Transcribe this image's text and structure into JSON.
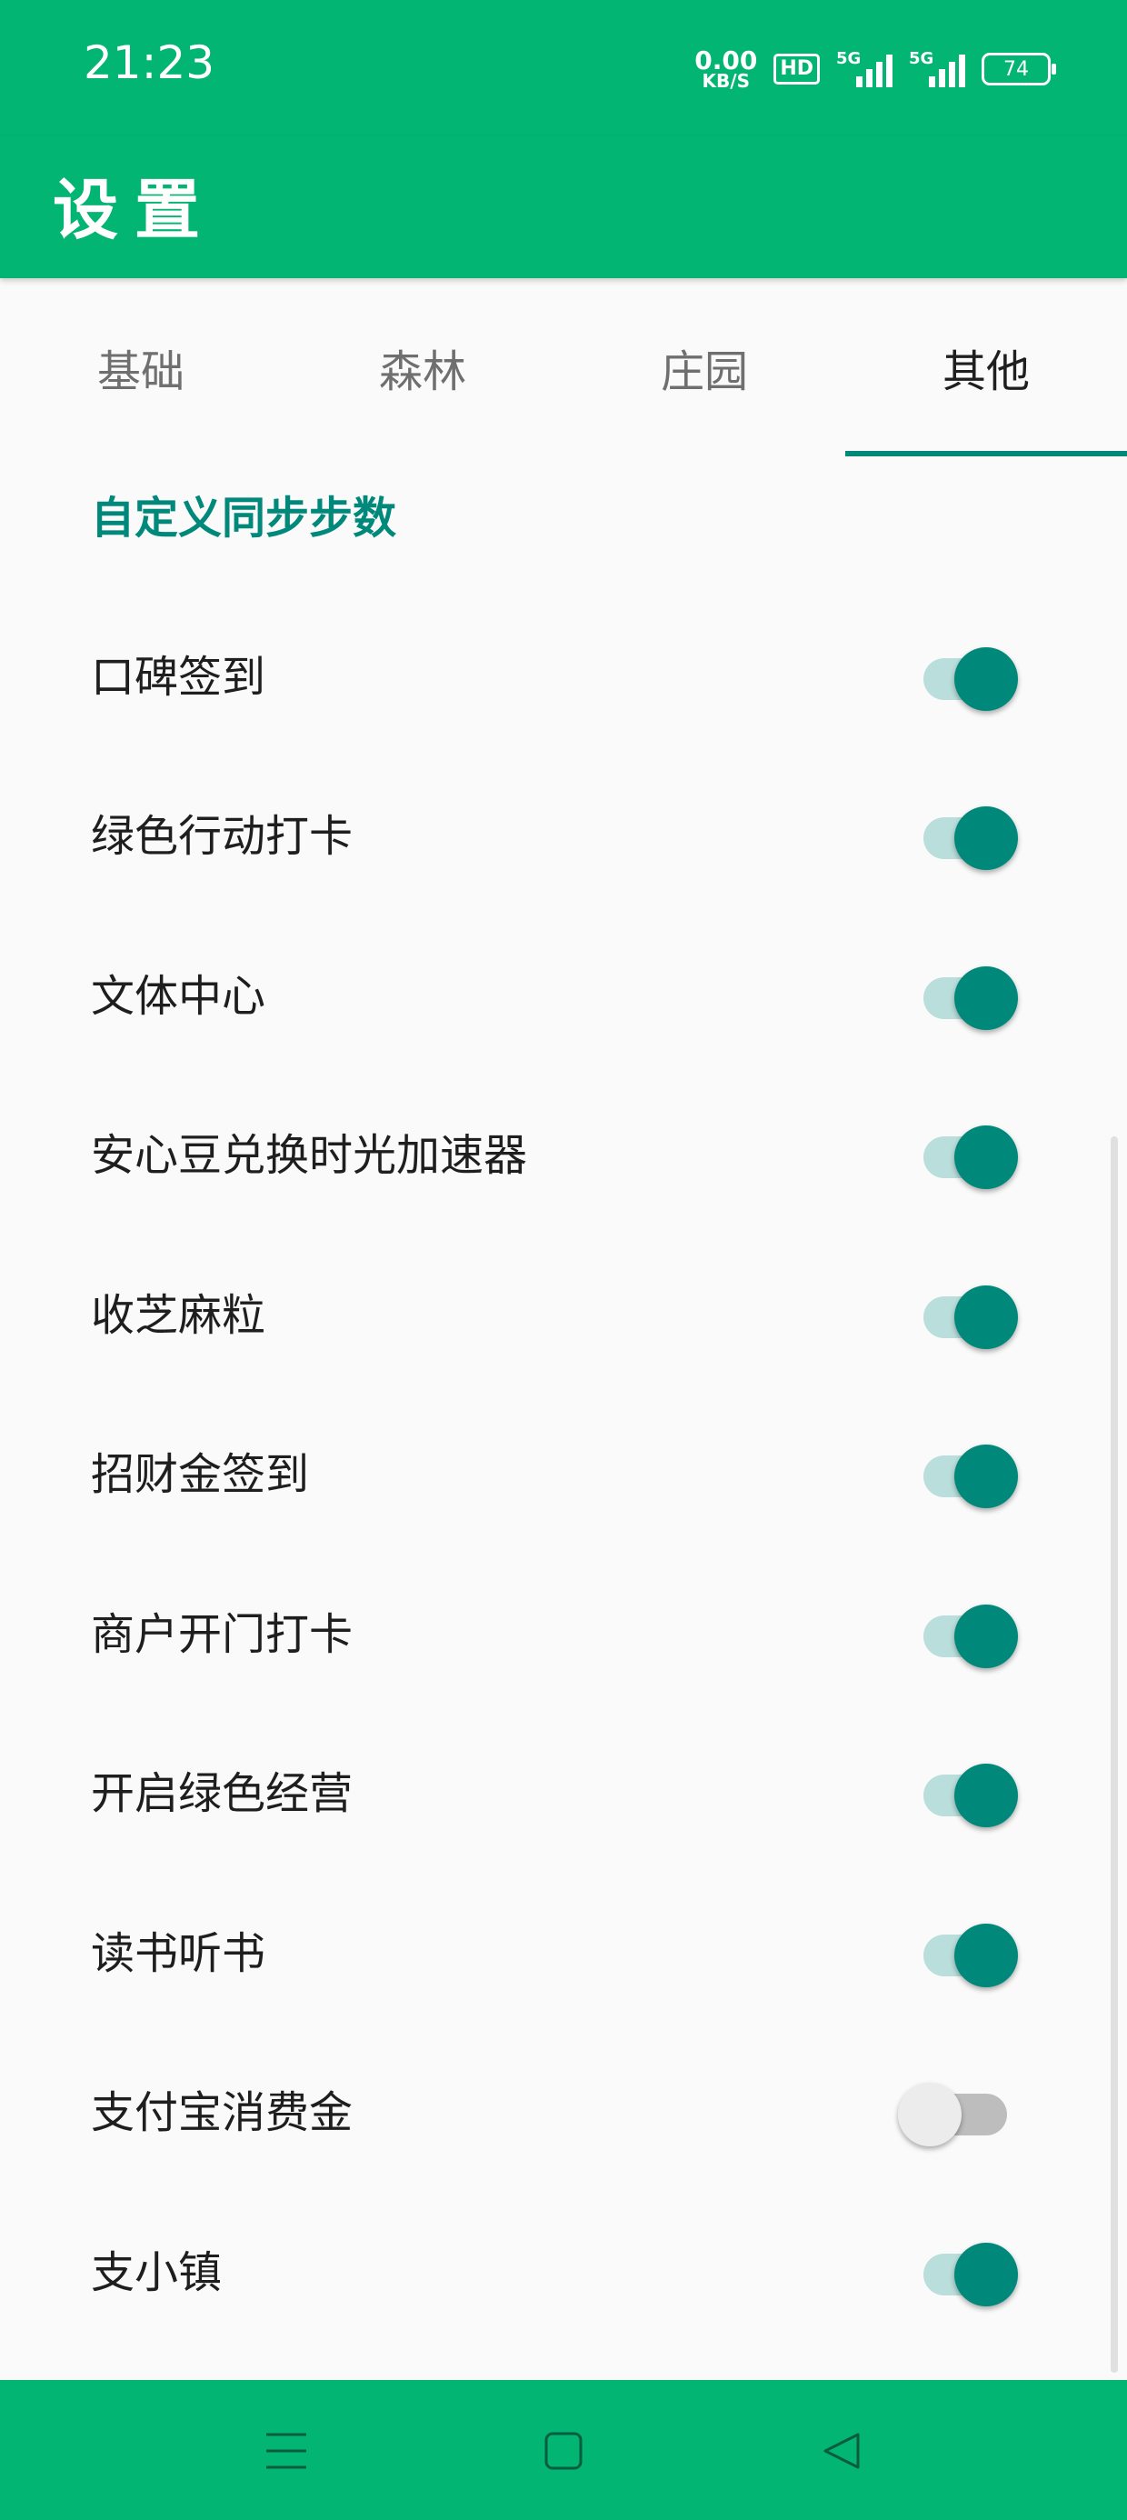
{
  "status_bar": {
    "time": "21:23",
    "net_speed_value": "0.00",
    "net_speed_unit": "KB/S",
    "hd_badge": "HD",
    "network_1": "5G",
    "network_2": "5G",
    "battery": "74"
  },
  "app_bar": {
    "title": "设置"
  },
  "tabs": [
    {
      "label": "基础",
      "active": false
    },
    {
      "label": "森林",
      "active": false
    },
    {
      "label": "庄园",
      "active": false
    },
    {
      "label": "其他",
      "active": true
    }
  ],
  "section": {
    "title": "自定义同步步数"
  },
  "settings": [
    {
      "label": "口碑签到",
      "enabled": true
    },
    {
      "label": "绿色行动打卡",
      "enabled": true
    },
    {
      "label": "文体中心",
      "enabled": true
    },
    {
      "label": "安心豆兑换时光加速器",
      "enabled": true
    },
    {
      "label": "收芝麻粒",
      "enabled": true
    },
    {
      "label": "招财金签到",
      "enabled": true
    },
    {
      "label": "商户开门打卡",
      "enabled": true
    },
    {
      "label": "开启绿色经营",
      "enabled": true
    },
    {
      "label": "读书听书",
      "enabled": true
    },
    {
      "label": "支付宝消费金",
      "enabled": false
    },
    {
      "label": "支小镇",
      "enabled": true
    }
  ],
  "colors": {
    "primary": "#03b572",
    "accent": "#00897b",
    "switch_track_on": "#b9dedb",
    "switch_track_off": "#bdbdbd"
  },
  "nav_icons": [
    "menu-icon",
    "home-square-icon",
    "back-triangle-icon"
  ]
}
